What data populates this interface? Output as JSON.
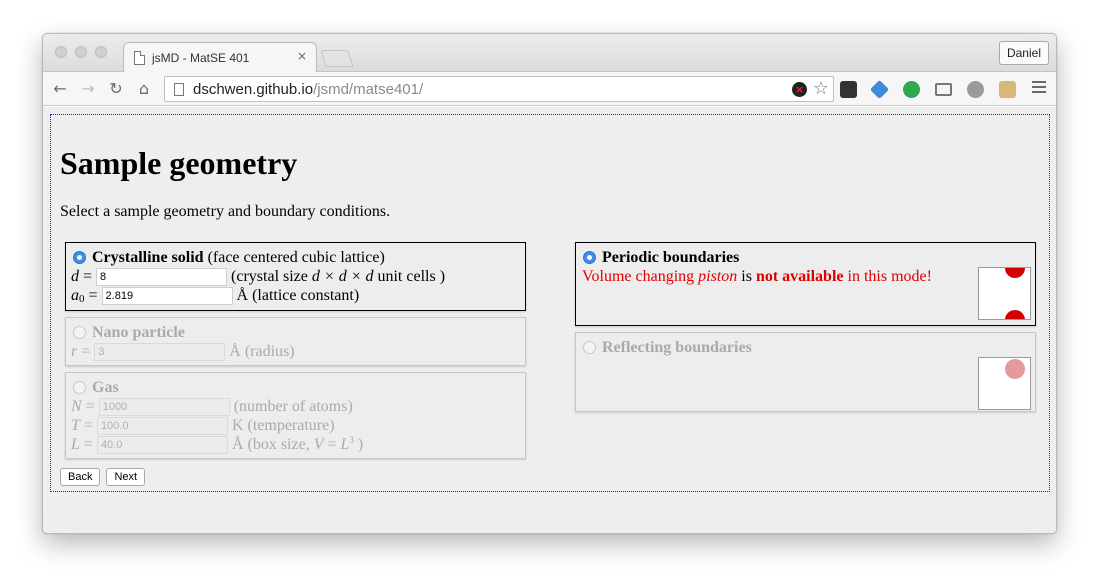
{
  "browser": {
    "tab_title": "jsMD - MatSE 401",
    "tab_close": "×",
    "user_button": "Daniel",
    "url_host": "dschwen.github.io",
    "url_path": "/jsmd/matse401/",
    "colors": {
      "tab_bg": "#f6f6f6",
      "toolbar_bg": "#f6f6f6",
      "ext_1": "#333333",
      "ext_2": "#3d8ddb",
      "ext_3": "#2fa84f"
    }
  },
  "page": {
    "title": "Sample geometry",
    "intro": "Select a sample geometry and boundary conditions."
  },
  "geometry": {
    "crystal": {
      "label": "Crystalline solid",
      "desc": "(face centered cubic lattice)",
      "d_var": "d",
      "d_value": "8",
      "d_desc_a": "(crystal size",
      "d_desc_expr": "d × d × d",
      "d_desc_b": "unit cells )",
      "a_var": "a",
      "a_sub": "0",
      "a_value": "2.819",
      "a_desc": "Å (lattice constant)",
      "selected": true
    },
    "nano": {
      "label": "Nano particle",
      "r_var": "r",
      "r_value": "3",
      "r_desc": "Å (radius)",
      "selected": false
    },
    "gas": {
      "label": "Gas",
      "n_var": "N",
      "n_value": "1000",
      "n_desc": "(number of atoms)",
      "t_var": "T",
      "t_value": "100.0",
      "t_desc": "K (temperature)",
      "l_var": "L",
      "l_value": "40.0",
      "l_desc_a": "Å (box size,",
      "l_desc_v": "V",
      "l_desc_eq": "=",
      "l_desc_l": "L",
      "l_desc_sup": "3",
      "l_desc_b": ")",
      "selected": false
    }
  },
  "boundary": {
    "periodic": {
      "label": "Periodic boundaries",
      "note_a": "Volume changing",
      "note_piston": "piston",
      "note_is": "is",
      "note_bold": "not available",
      "note_b": "in this mode!",
      "selected": true
    },
    "reflecting": {
      "label": "Reflecting boundaries",
      "selected": false
    },
    "colors": {
      "atom_active": "#d30000",
      "atom_inactive": "#e39a9a",
      "note": "#e00000"
    }
  },
  "nav": {
    "back": "Back",
    "next": "Next"
  },
  "eq": "="
}
